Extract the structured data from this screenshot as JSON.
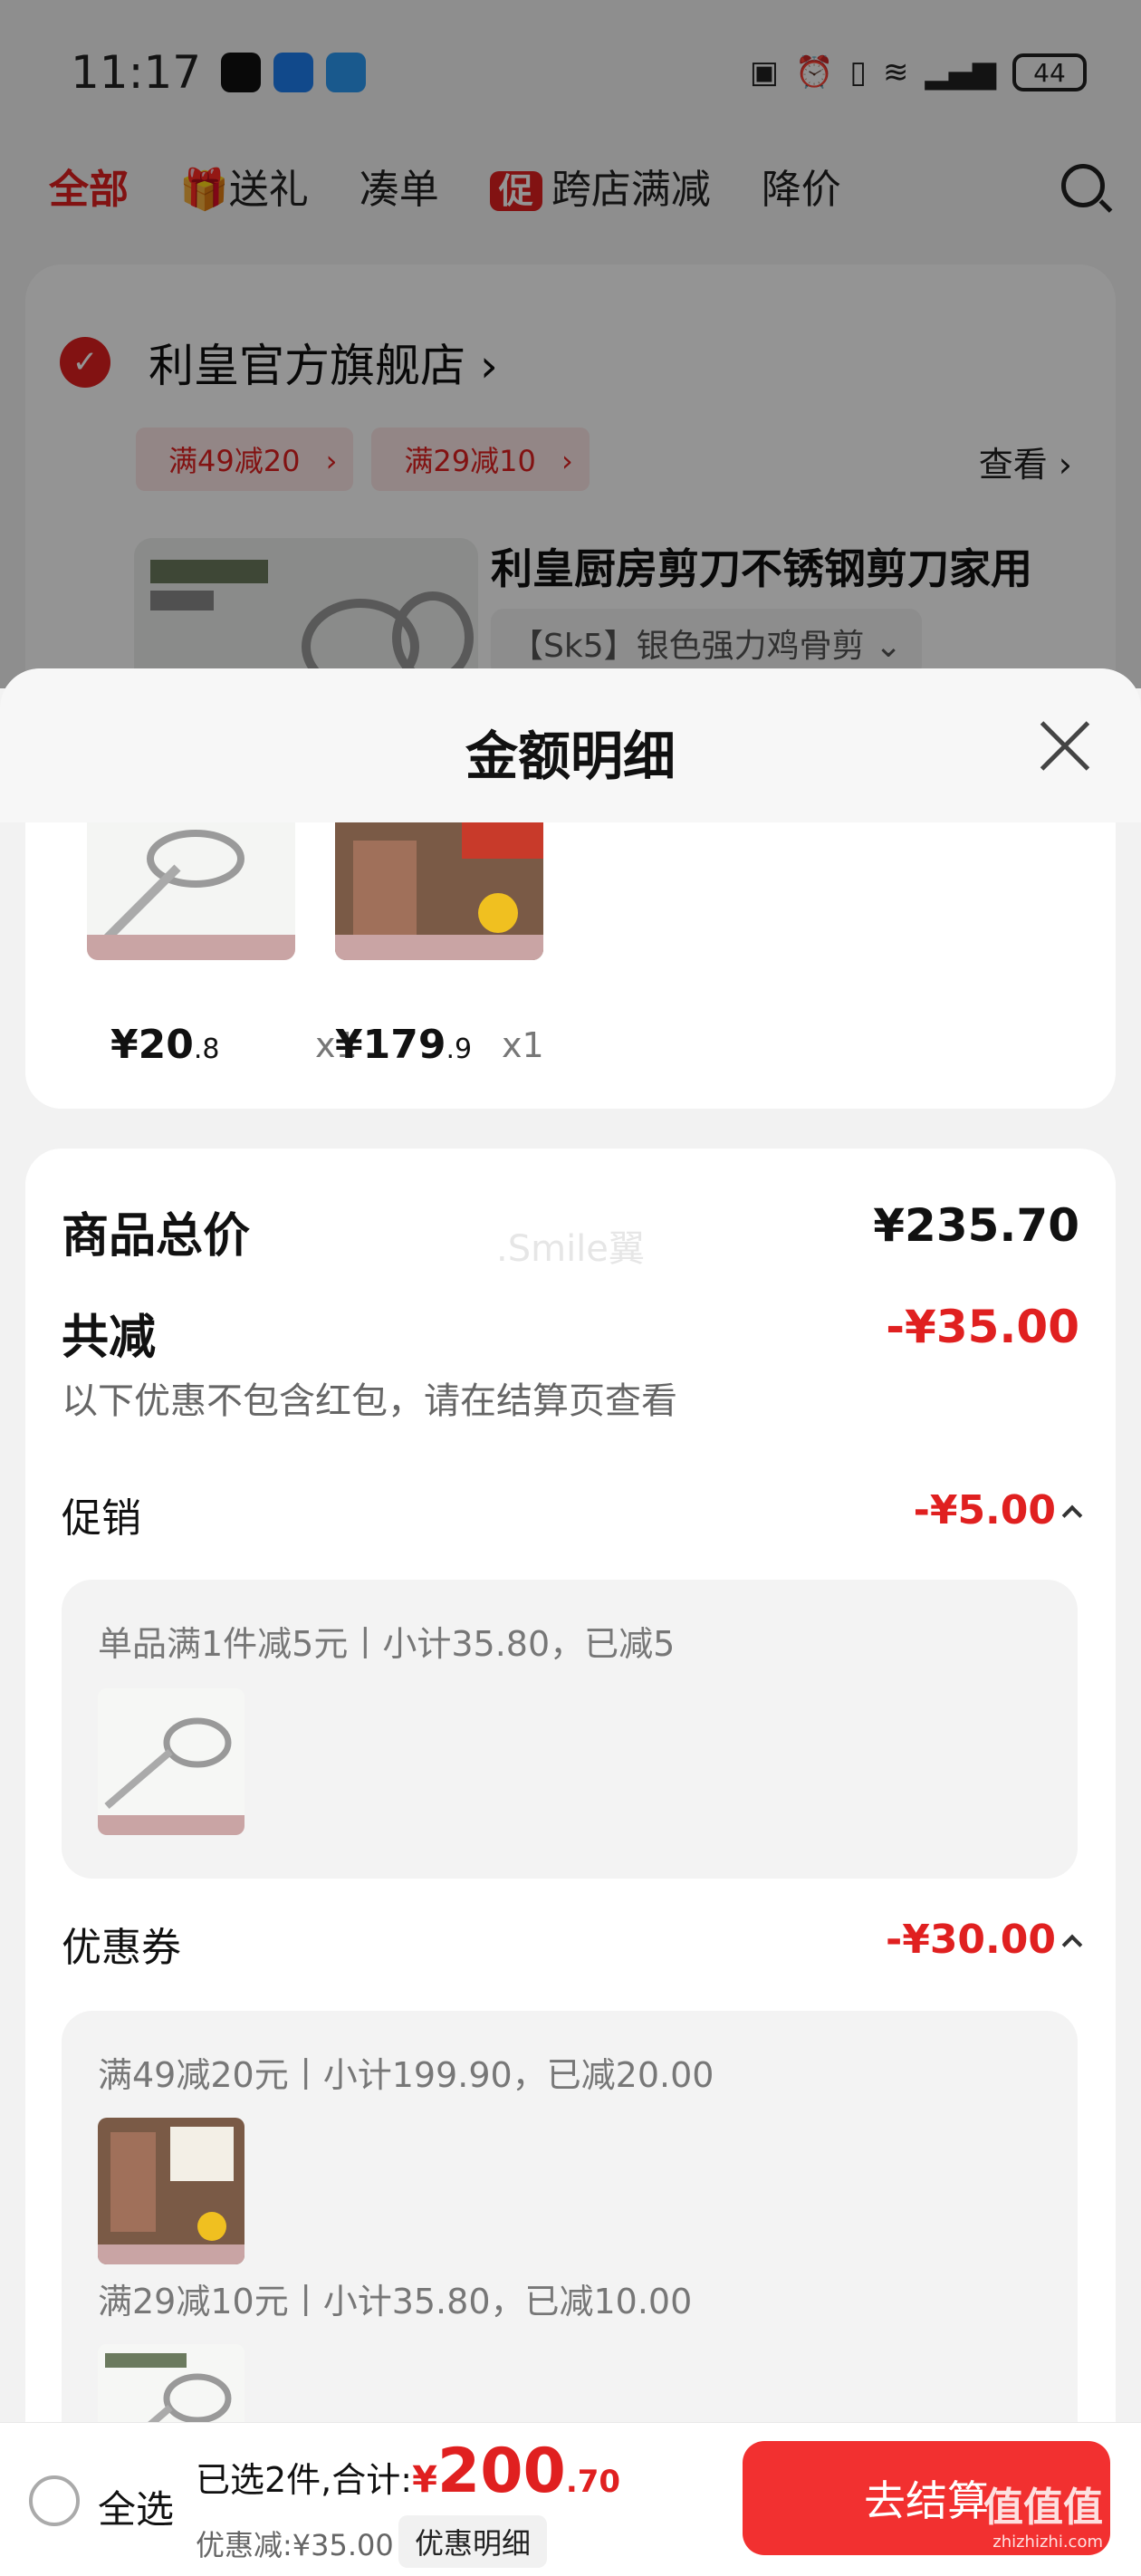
{
  "status_bar": {
    "time": "11:17",
    "battery": "44"
  },
  "top_tabs": [
    {
      "label": "全部"
    },
    {
      "label": "送礼"
    },
    {
      "label": "凑单"
    },
    {
      "label": "跨店满减",
      "tag": "促"
    },
    {
      "label": "降价"
    }
  ],
  "store": {
    "name": "利皇官方旗舰店",
    "coupons": [
      "满49减20",
      "满29减10"
    ],
    "view_label": "查看",
    "product_title": "利皇厨房剪刀不锈钢剪刀家用",
    "sku": "【Sk5】银色强力鸡骨剪"
  },
  "sheet": {
    "title": "金额明细",
    "items": [
      {
        "price_int": "¥20",
        "price_dec": ".8",
        "qty": "x1"
      },
      {
        "price_int": "¥179",
        "price_dec": ".9",
        "qty": "x1"
      }
    ],
    "total_label": "商品总价",
    "total_value": "¥235.70",
    "discount_label": "共减",
    "discount_value": "-¥35.00",
    "discount_note": "以下优惠不包含红包，请在结算页查看",
    "watermark": ".Smile翼",
    "promo": {
      "label": "促销",
      "amount": "-¥5.00",
      "rule": "单品满1件减5元丨小计35.80，已减5"
    },
    "coupon": {
      "label": "优惠券",
      "amount": "-¥30.00",
      "rules": [
        "满49减20元丨小计199.90，已减20.00",
        "满29减10元丨小计35.80，已减10.00"
      ]
    }
  },
  "bottom_bar": {
    "select_all": "全选",
    "summary_prefix": "已选2件,合计:",
    "currency": "¥",
    "total_int": "200",
    "total_dec": ".70",
    "discount_line": "优惠减:¥35.00",
    "detail_button": "优惠明细",
    "checkout_button": "去结算",
    "watermark": "值值值",
    "watermark_sub": "zhizhizhi.com"
  },
  "colors": {
    "accent": "#e02020",
    "checkout": "#f23030"
  }
}
